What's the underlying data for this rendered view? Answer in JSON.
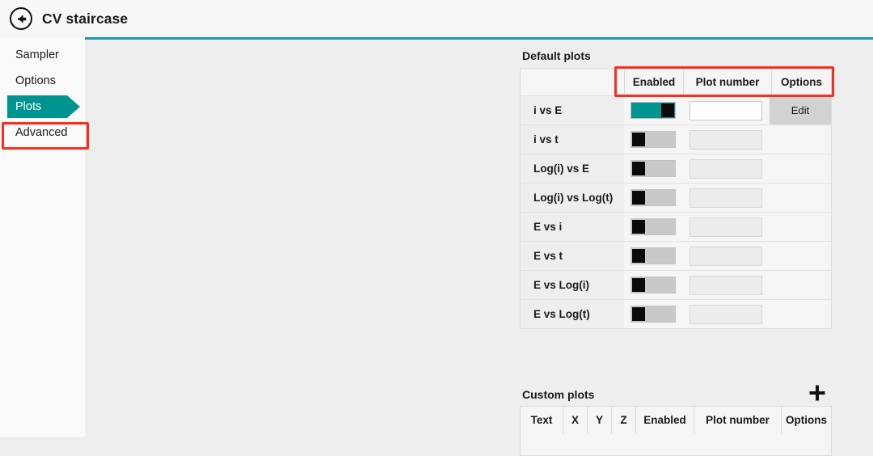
{
  "window": {
    "title": "CV staircase",
    "back_icon": "back-arrow-icon"
  },
  "sidebar": {
    "items": [
      {
        "label": "Sampler",
        "selected": false
      },
      {
        "label": "Options",
        "selected": false
      },
      {
        "label": "Plots",
        "selected": true
      },
      {
        "label": "Advanced",
        "selected": false
      }
    ]
  },
  "colors": {
    "accent_teal": "#009490",
    "rule_teal": "#1a9ba6",
    "highlight_red": "#fc2b1b",
    "content_bg": "#eeeeee",
    "sidebar_bg": "#fafafa",
    "button_gray": "#d2d2d2"
  },
  "default_plots": {
    "section_title": "Default plots",
    "columns": [
      "",
      "Enabled",
      "Plot number",
      "Options"
    ],
    "rows": [
      {
        "label": "i vs E",
        "enabled": true,
        "plot_number": "",
        "options_label": "Edit"
      },
      {
        "label": "i vs t",
        "enabled": false,
        "plot_number": "",
        "options_label": ""
      },
      {
        "label": "Log(i) vs E",
        "enabled": false,
        "plot_number": "",
        "options_label": ""
      },
      {
        "label": "Log(i) vs Log(t)",
        "enabled": false,
        "plot_number": "",
        "options_label": ""
      },
      {
        "label": "E vs i",
        "enabled": false,
        "plot_number": "",
        "options_label": ""
      },
      {
        "label": "E vs t",
        "enabled": false,
        "plot_number": "",
        "options_label": ""
      },
      {
        "label": "E vs Log(i)",
        "enabled": false,
        "plot_number": "",
        "options_label": ""
      },
      {
        "label": "E vs Log(t)",
        "enabled": false,
        "plot_number": "",
        "options_label": ""
      }
    ]
  },
  "custom_plots": {
    "section_title": "Custom plots",
    "add_icon": "plus-icon",
    "columns": [
      "Text",
      "X",
      "Y",
      "Z",
      "Enabled",
      "Plot number",
      "Options"
    ],
    "rows": []
  }
}
